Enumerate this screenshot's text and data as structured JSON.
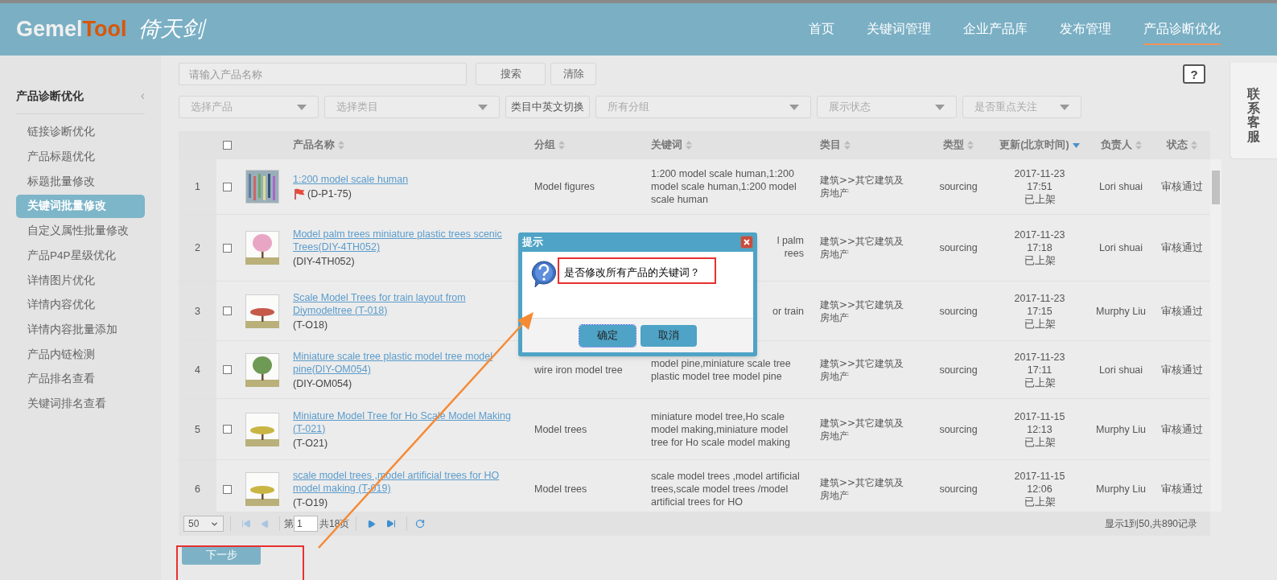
{
  "header": {
    "logo_main": "Gemel",
    "logo_accent": "Tool",
    "logo_script": "倚天剑",
    "nav": [
      {
        "label": "首页",
        "selected": false
      },
      {
        "label": "关键词管理",
        "selected": false
      },
      {
        "label": "企业产品库",
        "selected": false
      },
      {
        "label": "发布管理",
        "selected": false
      },
      {
        "label": "产品诊断优化",
        "selected": true
      }
    ]
  },
  "sidebar": {
    "title": "产品诊断优化",
    "collapse": "‹",
    "items": [
      {
        "label": "链接诊断优化",
        "selected": false
      },
      {
        "label": "产品标题优化",
        "selected": false
      },
      {
        "label": "标题批量修改",
        "selected": false
      },
      {
        "label": "关键词批量修改",
        "selected": true
      },
      {
        "label": "自定义属性批量修改",
        "selected": false
      },
      {
        "label": "产品P4P星级优化",
        "selected": false
      },
      {
        "label": "详情图片优化",
        "selected": false
      },
      {
        "label": "详情内容优化",
        "selected": false
      },
      {
        "label": "详情内容批量添加",
        "selected": false
      },
      {
        "label": "产品内链检测",
        "selected": false
      },
      {
        "label": "产品排名查看",
        "selected": false
      },
      {
        "label": "关键词排名查看",
        "selected": false
      }
    ]
  },
  "search": {
    "placeholder": "请输入产品名称",
    "buttons": [
      "搜索",
      "清除"
    ]
  },
  "help": "?",
  "filters": [
    {
      "kind": "select",
      "label": "选择产品"
    },
    {
      "kind": "select",
      "label": "选择类目"
    },
    {
      "kind": "button",
      "label": "类目中英文切换"
    },
    {
      "kind": "select",
      "label": "所有分组"
    },
    {
      "kind": "select",
      "label": "展示状态"
    },
    {
      "kind": "select",
      "label": "是否重点关注"
    }
  ],
  "table": {
    "header_checkbox": {
      "checked": false
    },
    "columns": [
      {
        "label": "产品名称",
        "sorted": false
      },
      {
        "label": "分组",
        "sorted": false
      },
      {
        "label": "关键词",
        "sorted": false
      },
      {
        "label": "类目",
        "sorted": false
      },
      {
        "label": "类型",
        "sorted": false
      },
      {
        "label": "更新(北京时间)",
        "sorted": true
      },
      {
        "label": "负责人",
        "sorted": false
      },
      {
        "label": "状态",
        "sorted": false
      }
    ],
    "rows": [
      {
        "index": "1",
        "checked": false,
        "name": "1:200 model scale human",
        "flag": true,
        "code": "(D-P1-75)",
        "group": "Model figures",
        "keywords": [
          {
            "kind": "line",
            "text": "1:200 model scale human,1:200 model scale human,1:200 model scale human"
          }
        ],
        "category": "建筑>>其它建筑及房地产",
        "type": "sourcing",
        "updated": [
          "2017-11-23",
          "17:51",
          "已上架"
        ],
        "owner": "Lori shuai",
        "status": "审核通过"
      },
      {
        "index": "2",
        "checked": false,
        "name": "Model palm trees miniature plastic trees scenic Trees(DIY-4TH052)",
        "flag": false,
        "code": "(DIY-4TH052)",
        "keywords": [
          {
            "kind": "tail",
            "text": "l palm"
          },
          {
            "kind": "tail",
            "text": "rees"
          }
        ],
        "category": "建筑>>其它建筑及房地产",
        "type": "sourcing",
        "updated": [
          "2017-11-23",
          "17:18",
          "已上架"
        ],
        "owner": "Lori shuai",
        "status": "审核通过"
      },
      {
        "index": "3",
        "checked": false,
        "name": "Scale Model Trees for train layout from Diymodeltree (T-018)",
        "flag": false,
        "code": "(T-O18)",
        "keywords": [
          {
            "kind": "tail",
            "text": "or train"
          }
        ],
        "category": "建筑>>其它建筑及房地产",
        "type": "sourcing",
        "updated": [
          "2017-11-23",
          "17:15",
          "已上架"
        ],
        "owner": "Murphy Liu",
        "status": "审核通过"
      },
      {
        "index": "4",
        "checked": false,
        "name": "Miniature scale tree plastic model tree model pine(DIY-OM054)",
        "flag": false,
        "code": "(DIY-OM054)",
        "group": "wire iron model tree",
        "keywords": [
          {
            "kind": "line",
            "text": "model pine,miniature scale tree plastic model tree model pine"
          }
        ],
        "category": "建筑>>其它建筑及房地产",
        "type": "sourcing",
        "updated": [
          "2017-11-23",
          "17:11",
          "已上架"
        ],
        "owner": "Lori shuai",
        "status": "审核通过"
      },
      {
        "index": "5",
        "checked": false,
        "name": "Miniature Model Tree for Ho Scale Model Making (T-021)",
        "flag": false,
        "code": "(T-O21)",
        "group": "Model trees",
        "keywords": [
          {
            "kind": "line",
            "text": "miniature model tree,Ho scale model making,miniature model tree for Ho scale model making"
          }
        ],
        "category": "建筑>>其它建筑及房地产",
        "type": "sourcing",
        "updated": [
          "2017-11-15",
          "12:13",
          "已上架"
        ],
        "owner": "Murphy Liu",
        "status": "审核通过"
      },
      {
        "index": "6",
        "checked": false,
        "name": "scale model trees ,model artificial trees for HO model making (T-019)",
        "flag": false,
        "code": "(T-O19)",
        "group": "Model trees",
        "keywords": [
          {
            "kind": "line",
            "text": "scale model trees ,model artificial trees,scale model trees /model artificial trees for HO"
          }
        ],
        "category": "建筑>>其它建筑及房地产",
        "type": "sourcing",
        "updated": [
          "2017-11-15",
          "12:06",
          "已上架"
        ],
        "owner": "Murphy Liu",
        "status": "审核通过"
      }
    ]
  },
  "pagination": {
    "page_size": "50",
    "page_prefix": "第",
    "page": "1",
    "total_pages": "共18页",
    "summary": "显示1到50,共890记录"
  },
  "next_button": "下一步",
  "dialog": {
    "title": "提示",
    "message": "是否修改所有产品的关键词？",
    "buttons": [
      {
        "label": "确定",
        "focused": true
      },
      {
        "label": "取消",
        "focused": false
      }
    ]
  },
  "annotations": {
    "message_frame": true,
    "next_button_frame": true,
    "arrow": true
  },
  "customer_service": "联系客服"
}
